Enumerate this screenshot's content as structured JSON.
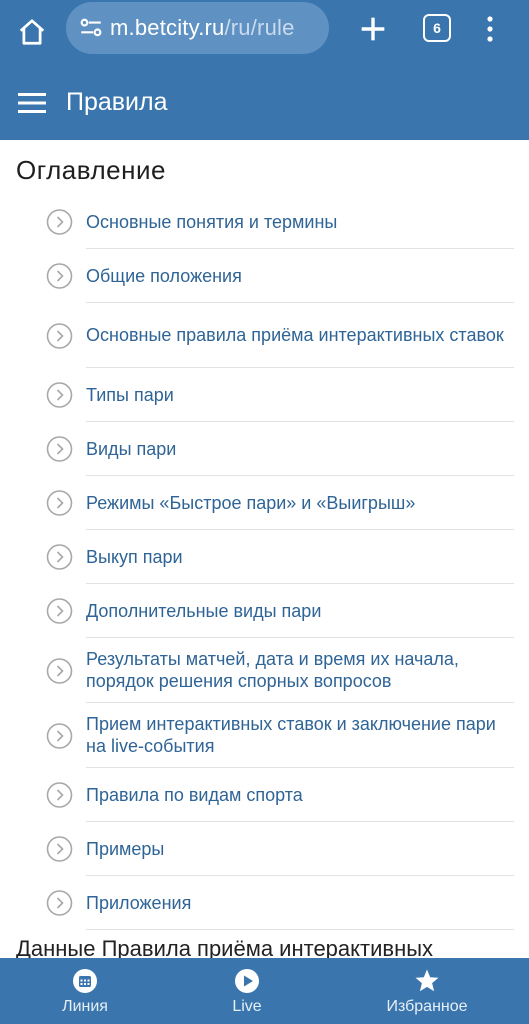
{
  "browser": {
    "url_domain": "m.betcity.ru",
    "url_path": "/ru/rule",
    "tab_count": "6"
  },
  "header": {
    "title": "Правила"
  },
  "toc": {
    "heading": "Оглавление",
    "items": [
      {
        "label": "Основные понятия и термины"
      },
      {
        "label": "Общие положения"
      },
      {
        "label": "Основные правила приёма интерактивных ставок"
      },
      {
        "label": "Типы пари"
      },
      {
        "label": "Виды пари"
      },
      {
        "label": "Режимы «Быстрое пари» и «Выигрыш»"
      },
      {
        "label": "Выкуп пари"
      },
      {
        "label": "Дополнительные виды пари"
      },
      {
        "label": "Результаты матчей, дата и время их начала, порядок решения спорных вопросов"
      },
      {
        "label": "Прием интерактивных ставок и заключение пари на live-события"
      },
      {
        "label": "Правила по видам спорта"
      },
      {
        "label": "Примеры"
      },
      {
        "label": "Приложения"
      }
    ]
  },
  "body_text": {
    "partial_line": "Данные Правила приёма интерактивных"
  },
  "bottom_nav": {
    "items": [
      {
        "label": "Линия",
        "icon": "calendar-icon"
      },
      {
        "label": "Live",
        "icon": "play-icon"
      },
      {
        "label": "Избранное",
        "icon": "star-icon"
      }
    ]
  },
  "colors": {
    "brand_blue": "#3a76ad",
    "link": "#2f6496"
  }
}
